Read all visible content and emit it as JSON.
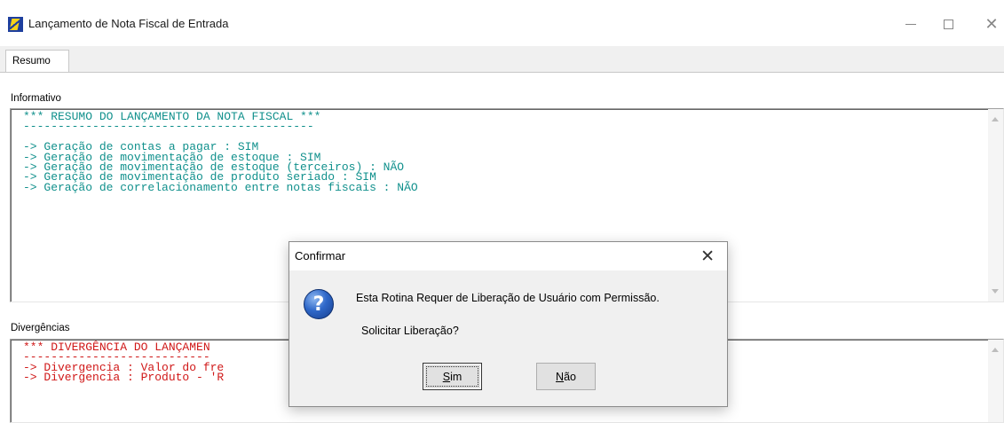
{
  "window": {
    "title": "Lançamento de Nota Fiscal de Entrada",
    "icon": "app-logo-icon",
    "controls": {
      "minimize": "minimize-icon",
      "maximize": "maximize-icon",
      "close": "✕"
    }
  },
  "tabs": [
    {
      "label": "Resumo",
      "selected": true
    }
  ],
  "informativo": {
    "label": "Informativo",
    "text_color": "#10908c",
    "lines": [
      "*** RESUMO DO LANÇAMENTO DA NOTA FISCAL ***",
      "------------------------------------------",
      "",
      "-> Geração de contas a pagar : SIM",
      "-> Geração de movimentação de estoque : SIM",
      "-> Geração de movimentação de estoque (terceiros) : NÃO",
      "-> Geração de movimentação de produto seriado : SIM",
      "-> Geração de correlacionamento entre notas fiscais : NÃO"
    ]
  },
  "divergencias": {
    "label": "Divergências",
    "text_color": "#d01818",
    "lines": [
      "*** DIVERGÊNCIA DO LANÇAMEN",
      "---------------------------",
      "-> Divergencia : Valor do fre",
      "-> Divergencia : Produto - 'R                                              pra"
    ]
  },
  "dialog": {
    "title": "Confirmar",
    "close_label": "✕",
    "icon": "question-icon",
    "icon_glyph": "?",
    "message": "Esta Rotina Requer de Liberação de Usuário com Permissão.",
    "question": "Solicitar Liberação?",
    "buttons": {
      "yes": {
        "mnemonic": "S",
        "rest": "im"
      },
      "no": {
        "mnemonic": "N",
        "rest": "ão"
      }
    }
  }
}
